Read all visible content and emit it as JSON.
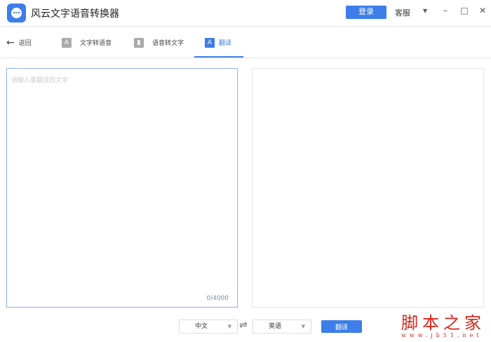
{
  "app": {
    "title": "风云文字语音转换器",
    "login": "登录",
    "service": "客服",
    "menu_icon": "▾",
    "min": "–",
    "max": "□",
    "close": "✕"
  },
  "tabs": {
    "back": "返回",
    "items": [
      {
        "label": "文字转语音",
        "icon": "A"
      },
      {
        "label": "语音转文字",
        "icon": "▮"
      },
      {
        "label": "翻译",
        "icon": "A"
      }
    ]
  },
  "editor": {
    "placeholder": "请输入要翻译的文字",
    "value": "",
    "count": "0/4000"
  },
  "controls": {
    "source_lang": "中文",
    "target_lang": "英语",
    "swap": "⇌",
    "translate": "翻译",
    "caret": "▼"
  },
  "watermark": {
    "title": "脚本之家",
    "url": "www.jb51.net"
  }
}
